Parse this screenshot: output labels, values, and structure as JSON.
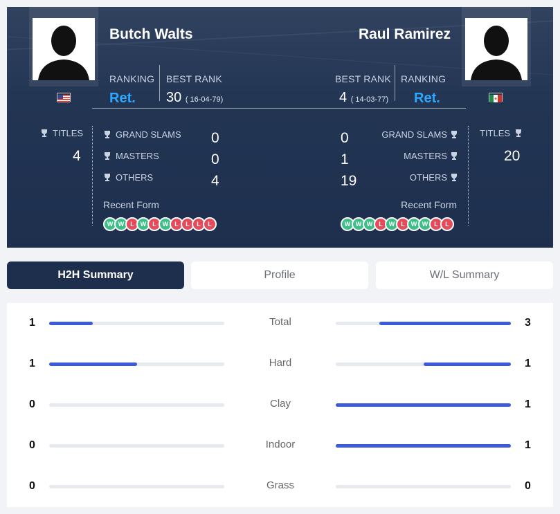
{
  "player1": {
    "name": "Butch Walts",
    "flag": "us-flag",
    "ranking_label": "RANKING",
    "ranking_value": "Ret.",
    "best_rank_label": "BEST RANK",
    "best_rank_value": "30",
    "best_rank_date": "( 16-04-79)",
    "titles_label": "TITLES",
    "titles_value": "4",
    "grand_slams_label": "GRAND SLAMS",
    "grand_slams_value": "0",
    "masters_label": "MASTERS",
    "masters_value": "0",
    "others_label": "OTHERS",
    "others_value": "4",
    "recent_form_label": "Recent Form",
    "recent_form": [
      "W",
      "W",
      "L",
      "W",
      "L",
      "W",
      "L",
      "L",
      "L",
      "L"
    ]
  },
  "player2": {
    "name": "Raul Ramirez",
    "flag": "mexico-flag",
    "ranking_label": "RANKING",
    "ranking_value": "Ret.",
    "best_rank_label": "BEST RANK",
    "best_rank_value": "4",
    "best_rank_date": "( 14-03-77)",
    "titles_label": "TITLES",
    "titles_value": "20",
    "grand_slams_label": "GRAND SLAMS",
    "grand_slams_value": "0",
    "masters_label": "MASTERS",
    "masters_value": "1",
    "others_label": "OTHERS",
    "others_value": "19",
    "recent_form_label": "Recent Form",
    "recent_form": [
      "W",
      "W",
      "W",
      "L",
      "W",
      "L",
      "W",
      "W",
      "L",
      "L"
    ]
  },
  "tabs": [
    {
      "label": "H2H Summary",
      "active": true
    },
    {
      "label": "Profile",
      "active": false
    },
    {
      "label": "W/L Summary",
      "active": false
    }
  ],
  "h2h": [
    {
      "category": "Total",
      "p1": "1",
      "p2": "3",
      "p1_fraction": 0.25,
      "p2_fraction": 0.75
    },
    {
      "category": "Hard",
      "p1": "1",
      "p2": "1",
      "p1_fraction": 0.5,
      "p2_fraction": 0.5
    },
    {
      "category": "Clay",
      "p1": "0",
      "p2": "1",
      "p1_fraction": 0,
      "p2_fraction": 1
    },
    {
      "category": "Indoor",
      "p1": "0",
      "p2": "1",
      "p1_fraction": 0,
      "p2_fraction": 1
    },
    {
      "category": "Grass",
      "p1": "0",
      "p2": "0",
      "p1_fraction": 0,
      "p2_fraction": 0
    }
  ],
  "colors": {
    "accent": "#3b5bdb",
    "ranking": "#2fa8ff",
    "win": "#3bbf87",
    "loss": "#e64b5c",
    "header_bg": "#1e2f4e"
  }
}
